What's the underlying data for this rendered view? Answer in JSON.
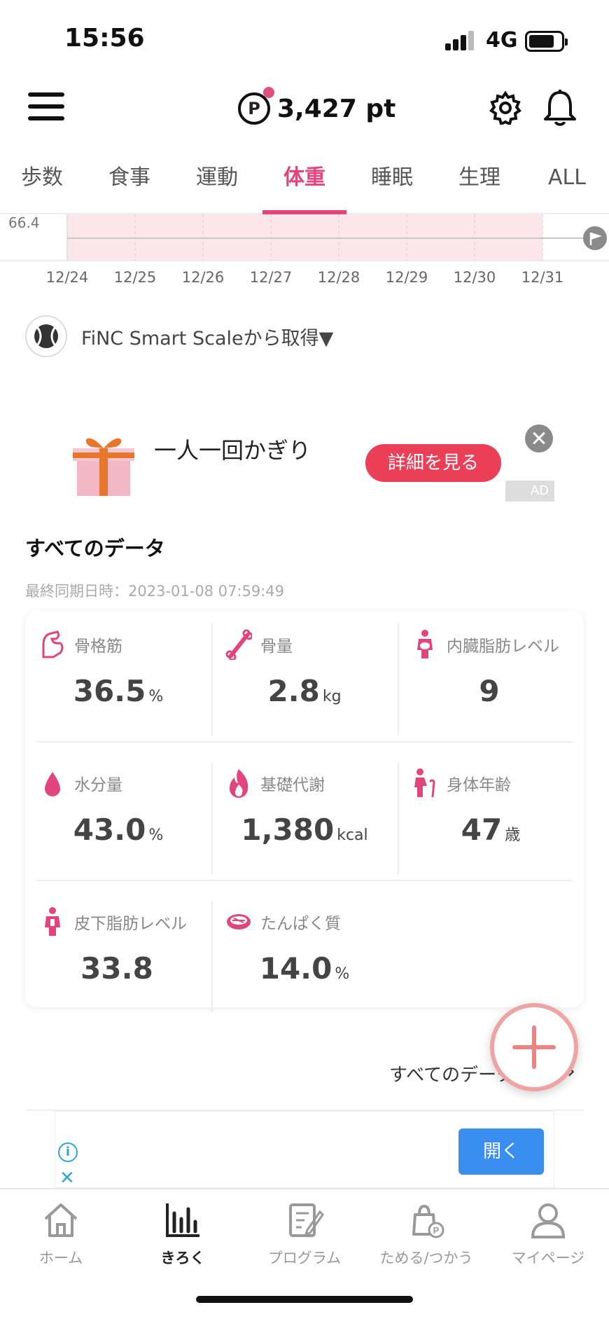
{
  "status_bar": {
    "time": "15:56",
    "network": "4G",
    "battery_level": 0.8
  },
  "header": {
    "points_badge": "P",
    "points": "3,427 pt"
  },
  "tabs": [
    {
      "label": "歩数",
      "active": false
    },
    {
      "label": "食事",
      "active": false
    },
    {
      "label": "運動",
      "active": false
    },
    {
      "label": "体重",
      "active": true
    },
    {
      "label": "睡眠",
      "active": false
    },
    {
      "label": "生理",
      "active": false
    },
    {
      "label": "ALL",
      "active": false
    }
  ],
  "chart_data": {
    "type": "line",
    "y_label_visible": "66.4",
    "x": [
      "12/24",
      "12/25",
      "12/26",
      "12/27",
      "12/28",
      "12/29",
      "12/30",
      "12/31"
    ],
    "series": [
      {
        "values": [
          66.4,
          66.4,
          66.4,
          66.4,
          66.4,
          66.4,
          66.4,
          66.4
        ]
      }
    ],
    "grid": true
  },
  "source": {
    "text": "FiNC Smart Scaleから取得▼"
  },
  "ad": {
    "text": "一人一回かぎり",
    "button": "詳細を見る",
    "tag": "AD"
  },
  "all_data": {
    "title": "すべてのデータ",
    "last_sync": "最終同期日時：2023-01-08 07:59:49",
    "items": [
      {
        "label": "骨格筋",
        "value": "36.5",
        "unit": "%",
        "icon": "muscle-icon"
      },
      {
        "label": "骨量",
        "value": "2.8",
        "unit": "kg",
        "icon": "bone-icon"
      },
      {
        "label": "内臓脂肪レベル",
        "value": "9",
        "unit": "",
        "icon": "visceral-fat-icon"
      },
      {
        "label": "水分量",
        "value": "43.0",
        "unit": "%",
        "icon": "water-drop-icon"
      },
      {
        "label": "基礎代謝",
        "value": "1,380",
        "unit": "kcal",
        "icon": "flame-icon"
      },
      {
        "label": "身体年齢",
        "value": "47",
        "unit": "歳",
        "icon": "elderly-icon"
      },
      {
        "label": "皮下脂肪レベル",
        "value": "33.8",
        "unit": "",
        "icon": "person-icon"
      },
      {
        "label": "たんぱく質",
        "value": "14.0",
        "unit": "%",
        "icon": "meat-icon"
      }
    ],
    "see_all": "すべてのデータ"
  },
  "bottom_ad": {
    "button": "開く",
    "info": "i",
    "close": "✕"
  },
  "bottom_nav": [
    {
      "label": "ホーム",
      "icon": "home-icon",
      "active": false
    },
    {
      "label": "きろく",
      "icon": "chart-icon",
      "active": true
    },
    {
      "label": "プログラム",
      "icon": "program-icon",
      "active": false
    },
    {
      "label": "ためる/つかう",
      "icon": "points-bag-icon",
      "active": false
    },
    {
      "label": "マイページ",
      "icon": "profile-icon",
      "active": false
    }
  ],
  "colors": {
    "accent": "#e2457b",
    "ad_button": "#ea3f57",
    "open_button": "#3a8ef0"
  }
}
